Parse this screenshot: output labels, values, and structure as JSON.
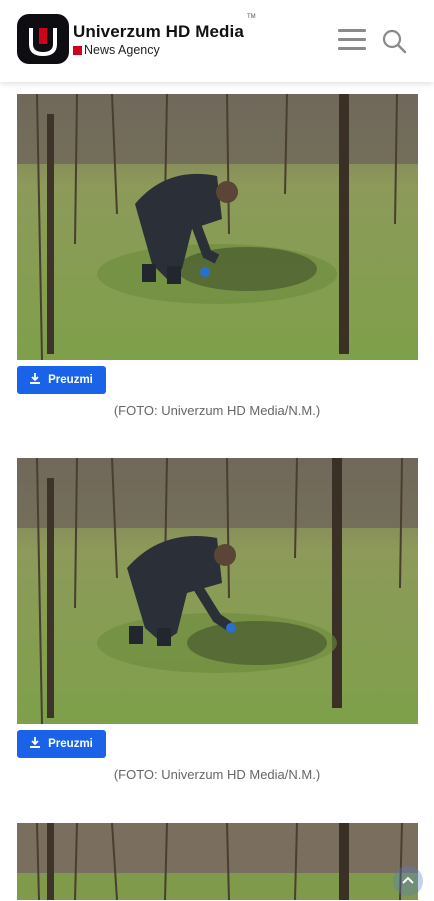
{
  "header": {
    "brand_name": "Univerzum HD Media",
    "brand_subtitle": "News Agency",
    "trademark": "TM",
    "logo_letter": "U",
    "icons": [
      "menu-icon",
      "search-icon"
    ]
  },
  "gallery": [
    {
      "button_label": "Preuzmi",
      "caption": "(FOTO: Univerzum HD Media/N.M.)"
    },
    {
      "button_label": "Preuzmi",
      "caption": "(FOTO: Univerzum HD Media/N.M.)"
    }
  ],
  "colors": {
    "accent_blue": "#1a63e8",
    "brand_red": "#d0021b",
    "logo_dark": "#0d0d12"
  }
}
